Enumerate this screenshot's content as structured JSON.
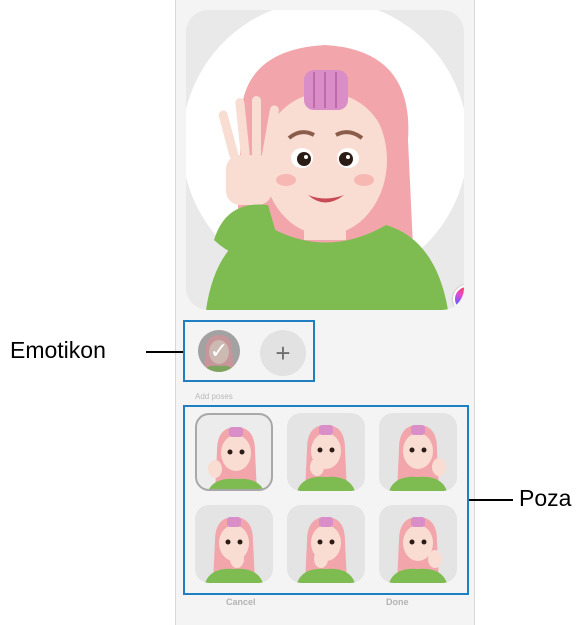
{
  "labels": {
    "emoticon": "Emotikon",
    "pose": "Poza"
  },
  "emoticon_section": {
    "add_symbol": "+",
    "selected_symbol": "✓"
  },
  "dialog": {
    "section_hint": "Add poses",
    "cancel": "Cancel",
    "done": "Done"
  },
  "colors": {
    "callout_border": "#1f7fc1",
    "hair": "#f2a6ac",
    "shirt": "#7ebc52",
    "roller": "#d98ec7"
  },
  "pose_count": 6,
  "selected_pose_index": 0
}
